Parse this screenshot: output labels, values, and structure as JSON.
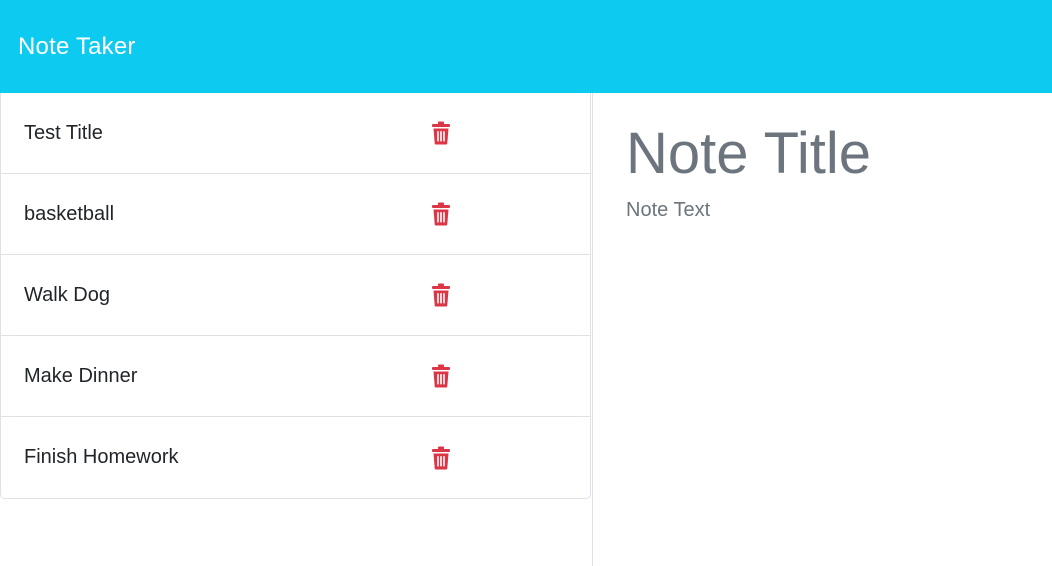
{
  "navbar": {
    "brand": "Note Taker",
    "background_color": "#0dcaf0"
  },
  "notes": [
    {
      "title": "Test Title"
    },
    {
      "title": "basketball"
    },
    {
      "title": "Walk Dog"
    },
    {
      "title": "Make Dinner"
    },
    {
      "title": "Finish Homework"
    }
  ],
  "delete_icon": {
    "name": "trash-icon",
    "color": "#dc3545"
  },
  "editor": {
    "title_placeholder": "Note Title",
    "text_placeholder": "Note Text"
  }
}
